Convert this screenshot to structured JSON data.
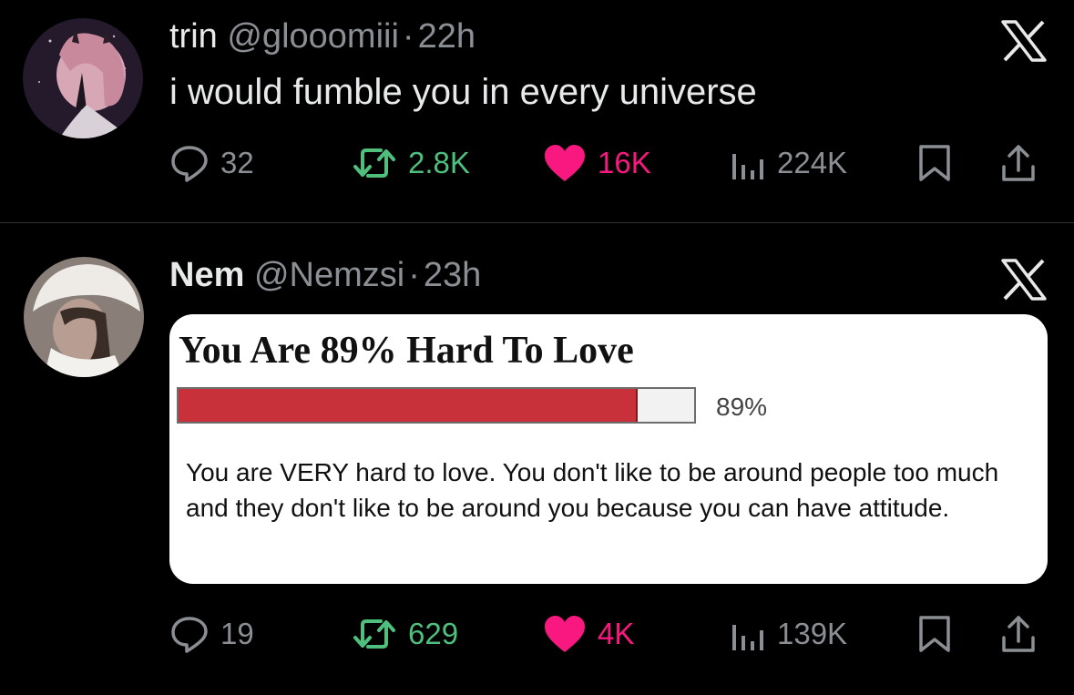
{
  "tweets": [
    {
      "name": "trin",
      "handle": "@glooomiii",
      "separator": "·",
      "time": "22h",
      "text": "i would fumble you in every universe",
      "stats": {
        "replies": "32",
        "reposts": "2.8K",
        "likes": "16K",
        "views": "224K"
      }
    },
    {
      "name": "Nem",
      "handle": "@Nemzsi",
      "separator": "·",
      "time": "23h",
      "quiz": {
        "title": "You Are 89% Hard To Love",
        "progress": 0.89,
        "percent_label": "89%",
        "description": "You are VERY hard to love. You don't like to be around people too much and they don't like to be around you because you can have attitude."
      },
      "stats": {
        "replies": "19",
        "reposts": "629",
        "likes": "4K",
        "views": "139K"
      }
    }
  ],
  "icons": {
    "reply": "speech-bubble-icon",
    "repost": "repost-arrows-icon",
    "like": "heart-icon",
    "views": "bar-chart-icon",
    "bookmark": "bookmark-icon",
    "share": "share-icon",
    "brand": "x-logo-icon"
  },
  "colors": {
    "background": "#000000",
    "muted": "#8b8f94",
    "repost": "#4fbf7e",
    "like": "#f91880",
    "bar_fill": "#c8303a"
  }
}
